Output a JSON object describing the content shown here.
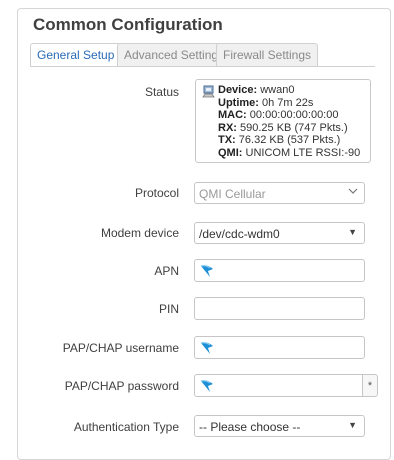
{
  "section": {
    "title": "Common Configuration"
  },
  "tabs": [
    {
      "label": "General Setup",
      "active": true
    },
    {
      "label": "Advanced Settings",
      "active": false
    },
    {
      "label": "Firewall Settings",
      "active": false
    }
  ],
  "status": {
    "label": "Status",
    "device_label": "Device:",
    "device": "wwan0",
    "uptime_label": "Uptime:",
    "uptime": "0h 7m 22s",
    "mac_label": "MAC:",
    "mac": "00:00:00:00:00:00",
    "rx_label": "RX:",
    "rx": "590.25 KB (747 Pkts.)",
    "tx_label": "TX:",
    "tx": "76.32 KB (537 Pkts.)",
    "qmi_label": "QMI:",
    "qmi": "UNICOM LTE RSSI:-90"
  },
  "fields": {
    "protocol": {
      "label": "Protocol",
      "value": "QMI Cellular"
    },
    "modem_device": {
      "label": "Modem device",
      "value": "/dev/cdc-wdm0"
    },
    "apn": {
      "label": "APN",
      "value": ""
    },
    "pin": {
      "label": "PIN",
      "value": ""
    },
    "pap_user": {
      "label": "PAP/CHAP username",
      "value": ""
    },
    "pap_pass": {
      "label": "PAP/CHAP password",
      "value": "",
      "reveal": "*"
    },
    "auth_type": {
      "label": "Authentication Type",
      "value": "-- Please choose --"
    }
  },
  "icons": {
    "device": "network-device-icon",
    "cursor": "pointer-cursor-icon"
  },
  "colors": {
    "tab_active": "#2a6bb7",
    "cursor": "#1e8fd6"
  }
}
